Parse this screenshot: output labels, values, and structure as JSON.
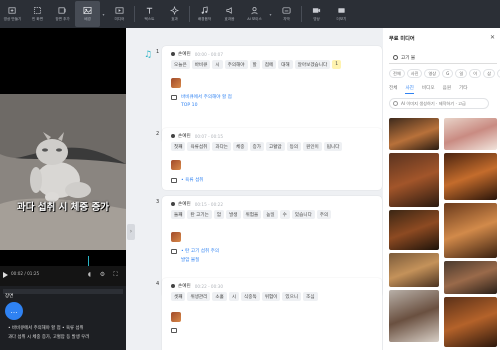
{
  "toolbar": {
    "items": [
      {
        "label": "영상 만들기",
        "icon": "video-plus-icon"
      },
      {
        "label": "빈 화면",
        "icon": "blank-screen-icon"
      },
      {
        "label": "장면 추가",
        "icon": "scene-add-icon"
      },
      {
        "label": "배경",
        "icon": "background-icon"
      },
      {
        "label": "미디어",
        "icon": "media-icon"
      },
      {
        "label": "텍스트",
        "icon": "text-icon"
      },
      {
        "label": "효과",
        "icon": "effects-icon"
      },
      {
        "label": "배경음악",
        "icon": "music-icon"
      },
      {
        "label": "효과음",
        "icon": "sound-effect-icon"
      },
      {
        "label": "AI 보이스",
        "icon": "voice-icon"
      },
      {
        "label": "자막",
        "icon": "caption-icon"
      },
      {
        "label": "영상",
        "icon": "film-icon"
      },
      {
        "label": "더보기",
        "icon": "more-icon"
      }
    ],
    "active_index": 3
  },
  "video": {
    "caption": "과다 섭취 시 체중 증가",
    "timecode": "00:02 / 01:25",
    "timeline_label": "장면",
    "timeline_lines": [
      "• 바비큐에서 주의해야 할 점 • 육류 섭취",
      "과다 섭취 시 체중 증가, 고혈압 등 발생 우려"
    ]
  },
  "scenes": [
    {
      "num": "1",
      "speaker": "손예린",
      "time": "00:00 - 00:07",
      "words": [
        "오늘은",
        "바비큐",
        "시",
        "주의해야",
        "할",
        "점에",
        "대해",
        "알아보겠습니다",
        "1"
      ],
      "highlight_index": 8,
      "media": "바비큐에서 주의해야 할 점",
      "media_sub": "TOP 10"
    },
    {
      "num": "2",
      "speaker": "손예린",
      "time": "00:07 - 00:15",
      "words": [
        "첫째",
        "육류섭취",
        "과다는",
        "체중",
        "증가",
        "고혈압",
        "등의",
        "원인이",
        "됩니다"
      ],
      "media": "• 육류 섭취",
      "media_sub": ""
    },
    {
      "num": "3",
      "speaker": "손예린",
      "time": "00:15 - 00:22",
      "words": [
        "둘째",
        "탄 고기는",
        "암",
        "발생",
        "위험을",
        "높일",
        "수",
        "있습니다",
        "주의"
      ],
      "media": "• 탄 고기 섭취 주의",
      "media_sub": "발암 물질"
    },
    {
      "num": "4",
      "speaker": "손예린",
      "time": "00:22 - 00:30",
      "words": [
        "셋째",
        "위생관리",
        "소홀",
        "시",
        "식중독",
        "위험이",
        "있으니",
        "조심"
      ],
      "media": "",
      "media_sub": ""
    }
  ],
  "media_panel": {
    "title": "무료 미디어",
    "search_value": "고기 불",
    "chips": [
      "전체",
      "사진",
      "영상",
      "G",
      "일",
      "이",
      "삼",
      "사",
      "오"
    ],
    "tabs": [
      "전체",
      "사진",
      "비디오",
      "음원",
      "기타"
    ],
    "active_tab": 1,
    "filter_text": "AI 이미지 생성하기 · 제작하기 · 고급"
  }
}
